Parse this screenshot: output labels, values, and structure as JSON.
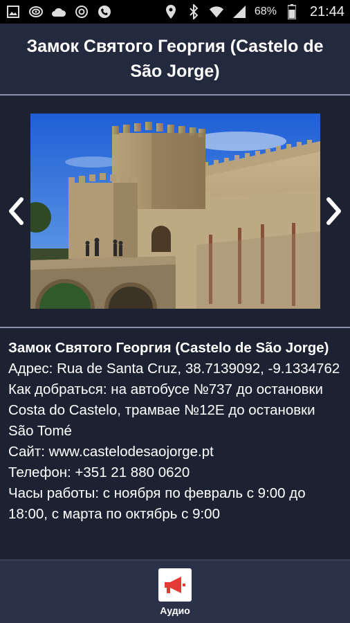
{
  "status_bar": {
    "battery": "68%",
    "time": "21:44",
    "left_icons": [
      "image-icon",
      "wifi-hotspot-icon",
      "cloud-icon",
      "at-icon",
      "phone-icon"
    ],
    "right_icons": [
      "location-icon",
      "bluetooth-icon",
      "wifi-icon",
      "signal-icon",
      "battery-icon"
    ]
  },
  "header": {
    "title": "Замок Святого Георгия (Castelo de São Jorge)"
  },
  "gallery": {
    "prev_icon": "chevron-left-icon",
    "next_icon": "chevron-right-icon"
  },
  "content": {
    "title": "Замок Святого Георгия (Castelo de São Jorge)",
    "address": "Адрес: Rua de Santa Cruz, 38.7139092, -9.1334762",
    "directions": "Как добраться: на автобусе №737 до остановки Costa do Castelo, трамвае №12E до остановки São Tomé",
    "website": "Сайт: www.castelodesaojorge.pt",
    "phone": "Телефон: +351 21 880 0620",
    "hours": "Часы работы: с ноября по февраль с 9:00 до 18:00, с марта по октябрь с 9:00"
  },
  "bottom_bar": {
    "audio_label": "Аудио",
    "audio_icon": "megaphone-icon"
  },
  "colors": {
    "background": "#1d2233",
    "header": "#232a3d",
    "bottom_bar": "#2b3148",
    "accent_red": "#e53935"
  }
}
